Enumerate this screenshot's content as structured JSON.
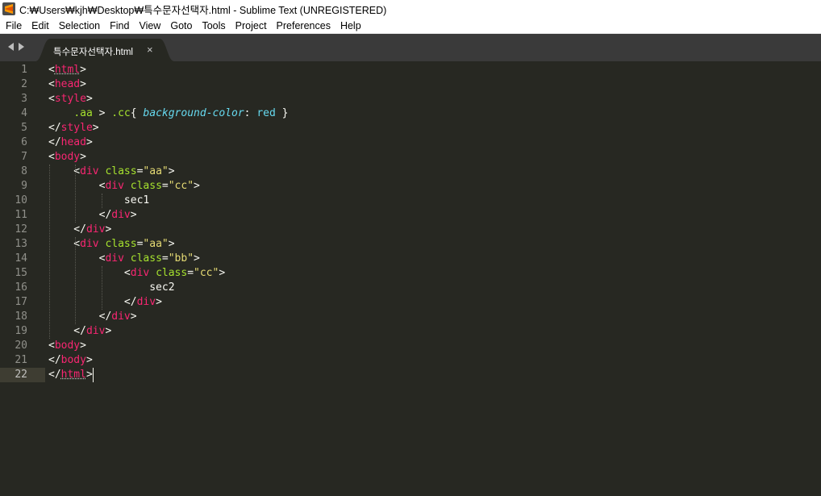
{
  "window": {
    "title": "C:₩Users₩kjh₩Desktop₩특수문자선택자.html - Sublime Text (UNREGISTERED)",
    "app_icon": "sublime-text-icon"
  },
  "menu": [
    "File",
    "Edit",
    "Selection",
    "Find",
    "View",
    "Goto",
    "Tools",
    "Project",
    "Preferences",
    "Help"
  ],
  "tab": {
    "label": "특수문자선택자.html",
    "close": "×"
  },
  "editor": {
    "current_line": 22,
    "lines": [
      [
        [
          "p",
          "<"
        ],
        [
          "t",
          "html"
        ],
        [
          "p",
          ">"
        ]
      ],
      [
        [
          "p",
          "<"
        ],
        [
          "t",
          "head"
        ],
        [
          "p",
          ">"
        ]
      ],
      [
        [
          "p",
          "<"
        ],
        [
          "t",
          "style"
        ],
        [
          "p",
          ">"
        ]
      ],
      [
        [
          "p",
          "    "
        ],
        [
          "sel",
          ".aa"
        ],
        [
          "p",
          " > "
        ],
        [
          "sel",
          ".cc"
        ],
        [
          "p",
          "{ "
        ],
        [
          "prop",
          "background-color"
        ],
        [
          "p",
          ": "
        ],
        [
          "v",
          "red"
        ],
        [
          "p",
          " }"
        ]
      ],
      [
        [
          "p",
          "</"
        ],
        [
          "t",
          "style"
        ],
        [
          "p",
          ">"
        ]
      ],
      [
        [
          "p",
          "</"
        ],
        [
          "t",
          "head"
        ],
        [
          "p",
          ">"
        ]
      ],
      [
        [
          "p",
          "<"
        ],
        [
          "t",
          "body"
        ],
        [
          "p",
          ">"
        ]
      ],
      [
        [
          "p",
          "    <"
        ],
        [
          "t",
          "div"
        ],
        [
          "p",
          " "
        ],
        [
          "a",
          "class"
        ],
        [
          "p",
          "="
        ],
        [
          "s",
          "\"aa\""
        ],
        [
          "p",
          ">"
        ]
      ],
      [
        [
          "p",
          "        <"
        ],
        [
          "t",
          "div"
        ],
        [
          "p",
          " "
        ],
        [
          "a",
          "class"
        ],
        [
          "p",
          "="
        ],
        [
          "s",
          "\"cc\""
        ],
        [
          "p",
          ">"
        ]
      ],
      [
        [
          "p",
          "            sec1"
        ]
      ],
      [
        [
          "p",
          "        </"
        ],
        [
          "t",
          "div"
        ],
        [
          "p",
          ">"
        ]
      ],
      [
        [
          "p",
          "    </"
        ],
        [
          "t",
          "div"
        ],
        [
          "p",
          ">"
        ]
      ],
      [
        [
          "p",
          "    <"
        ],
        [
          "t",
          "div"
        ],
        [
          "p",
          " "
        ],
        [
          "a",
          "class"
        ],
        [
          "p",
          "="
        ],
        [
          "s",
          "\"aa\""
        ],
        [
          "p",
          ">"
        ]
      ],
      [
        [
          "p",
          "        <"
        ],
        [
          "t",
          "div"
        ],
        [
          "p",
          " "
        ],
        [
          "a",
          "class"
        ],
        [
          "p",
          "="
        ],
        [
          "s",
          "\"bb\""
        ],
        [
          "p",
          ">"
        ]
      ],
      [
        [
          "p",
          "            <"
        ],
        [
          "t",
          "div"
        ],
        [
          "p",
          " "
        ],
        [
          "a",
          "class"
        ],
        [
          "p",
          "="
        ],
        [
          "s",
          "\"cc\""
        ],
        [
          "p",
          ">"
        ]
      ],
      [
        [
          "p",
          "                sec2"
        ]
      ],
      [
        [
          "p",
          "            </"
        ],
        [
          "t",
          "div"
        ],
        [
          "p",
          ">"
        ]
      ],
      [
        [
          "p",
          "        </"
        ],
        [
          "t",
          "div"
        ],
        [
          "p",
          ">"
        ]
      ],
      [
        [
          "p",
          "    </"
        ],
        [
          "t",
          "div"
        ],
        [
          "p",
          ">"
        ]
      ],
      [
        [
          "p",
          "<"
        ],
        [
          "t",
          "body"
        ],
        [
          "p",
          ">"
        ]
      ],
      [
        [
          "p",
          "</"
        ],
        [
          "t",
          "body"
        ],
        [
          "p",
          ">"
        ]
      ],
      [
        [
          "p",
          "</"
        ],
        [
          "t",
          "html"
        ],
        [
          "p",
          ">"
        ]
      ]
    ]
  },
  "colors": {
    "background": "#272822",
    "tag": "#f92672",
    "attribute": "#a6e22e",
    "string": "#e6db74",
    "property": "#66d9ef",
    "text": "#f8f8f2",
    "gutter_text": "#90908a"
  }
}
